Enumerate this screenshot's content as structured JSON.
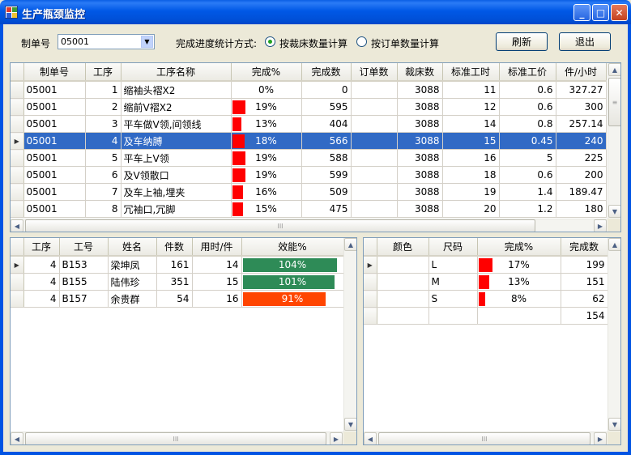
{
  "window": {
    "title": "生产瓶颈监控"
  },
  "toolbar": {
    "order_label": "制单号",
    "order_value": "05001",
    "mode_label": "完成进度统计方式:",
    "radio_cut": "按裁床数量计算",
    "radio_order": "按订单数量计算",
    "refresh": "刷新",
    "exit": "退出"
  },
  "process_grid": {
    "headers": [
      "制单号",
      "工序",
      "工序名称",
      "完成%",
      "完成数",
      "订单数",
      "裁床数",
      "标准工时",
      "标准工价",
      "件/小时"
    ],
    "rows": [
      {
        "order": "05001",
        "step": "1",
        "name": "缩袖头褶X2",
        "pct": 0,
        "pct_label": "0%",
        "done": "0",
        "order_qty": "",
        "cut": "3088",
        "std_time": "11",
        "std_price": "0.6",
        "per_hour": "327.27"
      },
      {
        "order": "05001",
        "step": "2",
        "name": "缩前V褶X2",
        "pct": 19,
        "pct_label": "19%",
        "done": "595",
        "order_qty": "",
        "cut": "3088",
        "std_time": "12",
        "std_price": "0.6",
        "per_hour": "300"
      },
      {
        "order": "05001",
        "step": "3",
        "name": "平车做V领,间领线",
        "pct": 13,
        "pct_label": "13%",
        "done": "404",
        "order_qty": "",
        "cut": "3088",
        "std_time": "14",
        "std_price": "0.8",
        "per_hour": "257.14"
      },
      {
        "order": "05001",
        "step": "4",
        "name": "及车纳膊",
        "pct": 18,
        "pct_label": "18%",
        "done": "566",
        "order_qty": "",
        "cut": "3088",
        "std_time": "15",
        "std_price": "0.45",
        "per_hour": "240"
      },
      {
        "order": "05001",
        "step": "5",
        "name": "平车上V领",
        "pct": 19,
        "pct_label": "19%",
        "done": "588",
        "order_qty": "",
        "cut": "3088",
        "std_time": "16",
        "std_price": "5",
        "per_hour": "225"
      },
      {
        "order": "05001",
        "step": "6",
        "name": "及V领散口",
        "pct": 19,
        "pct_label": "19%",
        "done": "599",
        "order_qty": "",
        "cut": "3088",
        "std_time": "18",
        "std_price": "0.6",
        "per_hour": "200"
      },
      {
        "order": "05001",
        "step": "7",
        "name": "及车上袖,埋夹",
        "pct": 16,
        "pct_label": "16%",
        "done": "509",
        "order_qty": "",
        "cut": "3088",
        "std_time": "19",
        "std_price": "1.4",
        "per_hour": "189.47"
      },
      {
        "order": "05001",
        "step": "8",
        "name": "冗袖口,冗脚",
        "pct": 15,
        "pct_label": "15%",
        "done": "475",
        "order_qty": "",
        "cut": "3088",
        "std_time": "20",
        "std_price": "1.2",
        "per_hour": "180"
      }
    ]
  },
  "worker_grid": {
    "headers": [
      "工序",
      "工号",
      "姓名",
      "件数",
      "用时/件",
      "效能%"
    ],
    "rows": [
      {
        "step": "4",
        "id": "B153",
        "name": "梁坤凤",
        "qty": "161",
        "time": "14",
        "eff": 104,
        "eff_label": "104%",
        "color": "#2e8b57"
      },
      {
        "step": "4",
        "id": "B155",
        "name": "陆伟珍",
        "qty": "351",
        "time": "15",
        "eff": 101,
        "eff_label": "101%",
        "color": "#2e8b57"
      },
      {
        "step": "4",
        "id": "B157",
        "name": "余贵群",
        "qty": "54",
        "time": "16",
        "eff": 91,
        "eff_label": "91%",
        "color": "#ff4500"
      }
    ]
  },
  "size_grid": {
    "headers": [
      "颜色",
      "尺码",
      "完成%",
      "完成数"
    ],
    "rows": [
      {
        "color": "",
        "size": "L",
        "pct": 17,
        "pct_label": "17%",
        "done": "199"
      },
      {
        "color": "",
        "size": "M",
        "pct": 13,
        "pct_label": "13%",
        "done": "151"
      },
      {
        "color": "",
        "size": "S",
        "pct": 8,
        "pct_label": "8%",
        "done": "62"
      }
    ],
    "total": "154"
  },
  "selected_row_index": 3,
  "colors": {
    "selection": "#316ac5",
    "progress_bar": "#ff0000",
    "titlebar": "#0054e3"
  }
}
